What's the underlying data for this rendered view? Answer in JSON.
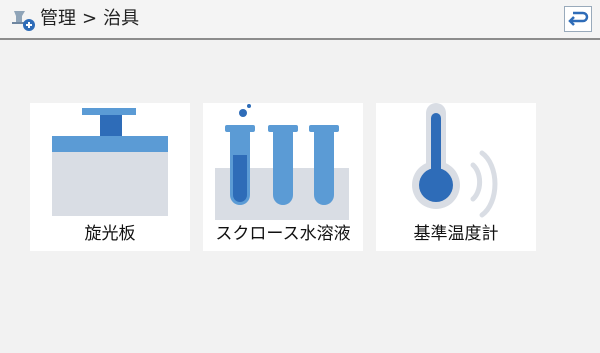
{
  "header": {
    "app_icon": "flask-settings-icon",
    "breadcrumb": {
      "parent": "管理",
      "separator": ">",
      "current": "治具"
    },
    "back_icon": "return-arrow-icon"
  },
  "tiles": [
    {
      "label": "旋光板",
      "icon": "polarizer-plate-icon"
    },
    {
      "label": "スクロース水溶液",
      "icon": "test-tubes-icon"
    },
    {
      "label": "基準温度計",
      "icon": "thermometer-icon"
    }
  ],
  "colors": {
    "blue_light": "#5b9bd5",
    "blue_dark": "#2e6cb8",
    "gray_light": "#d9dde4",
    "header_border": "#8c8c8c"
  }
}
